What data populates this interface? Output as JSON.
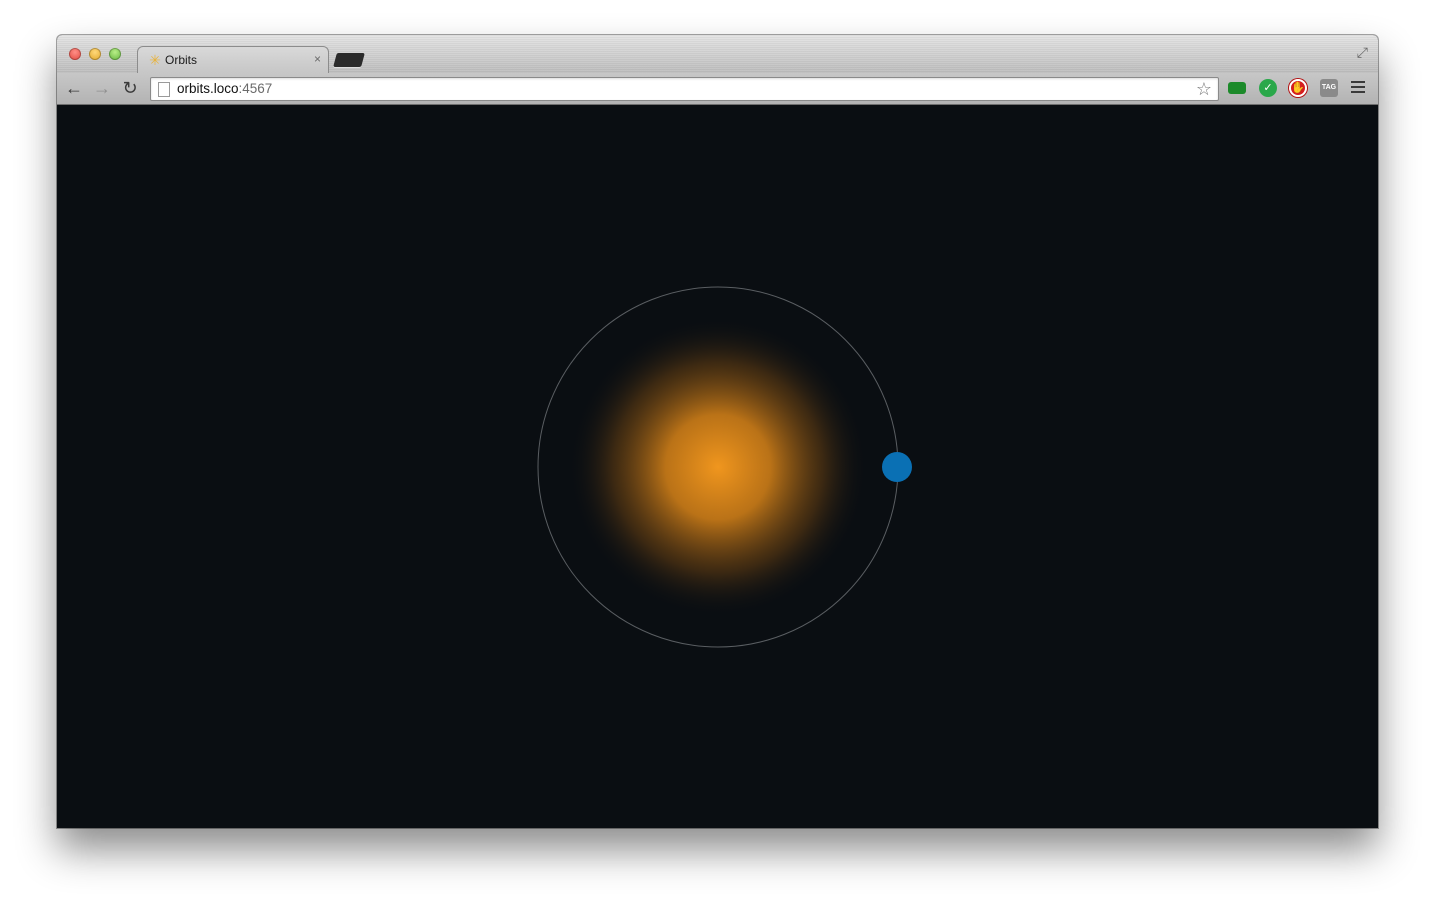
{
  "browser": {
    "tab_title": "Orbits",
    "tab_favicon": "sun-icon",
    "tab_close": "×",
    "url_host": "orbits.loco",
    "url_port": ":4567"
  },
  "page": {
    "background": "#0a0e12",
    "sun_color": "#f0961e",
    "planet_color": "#0a70b4",
    "orbit_color": "#5a5e62"
  }
}
